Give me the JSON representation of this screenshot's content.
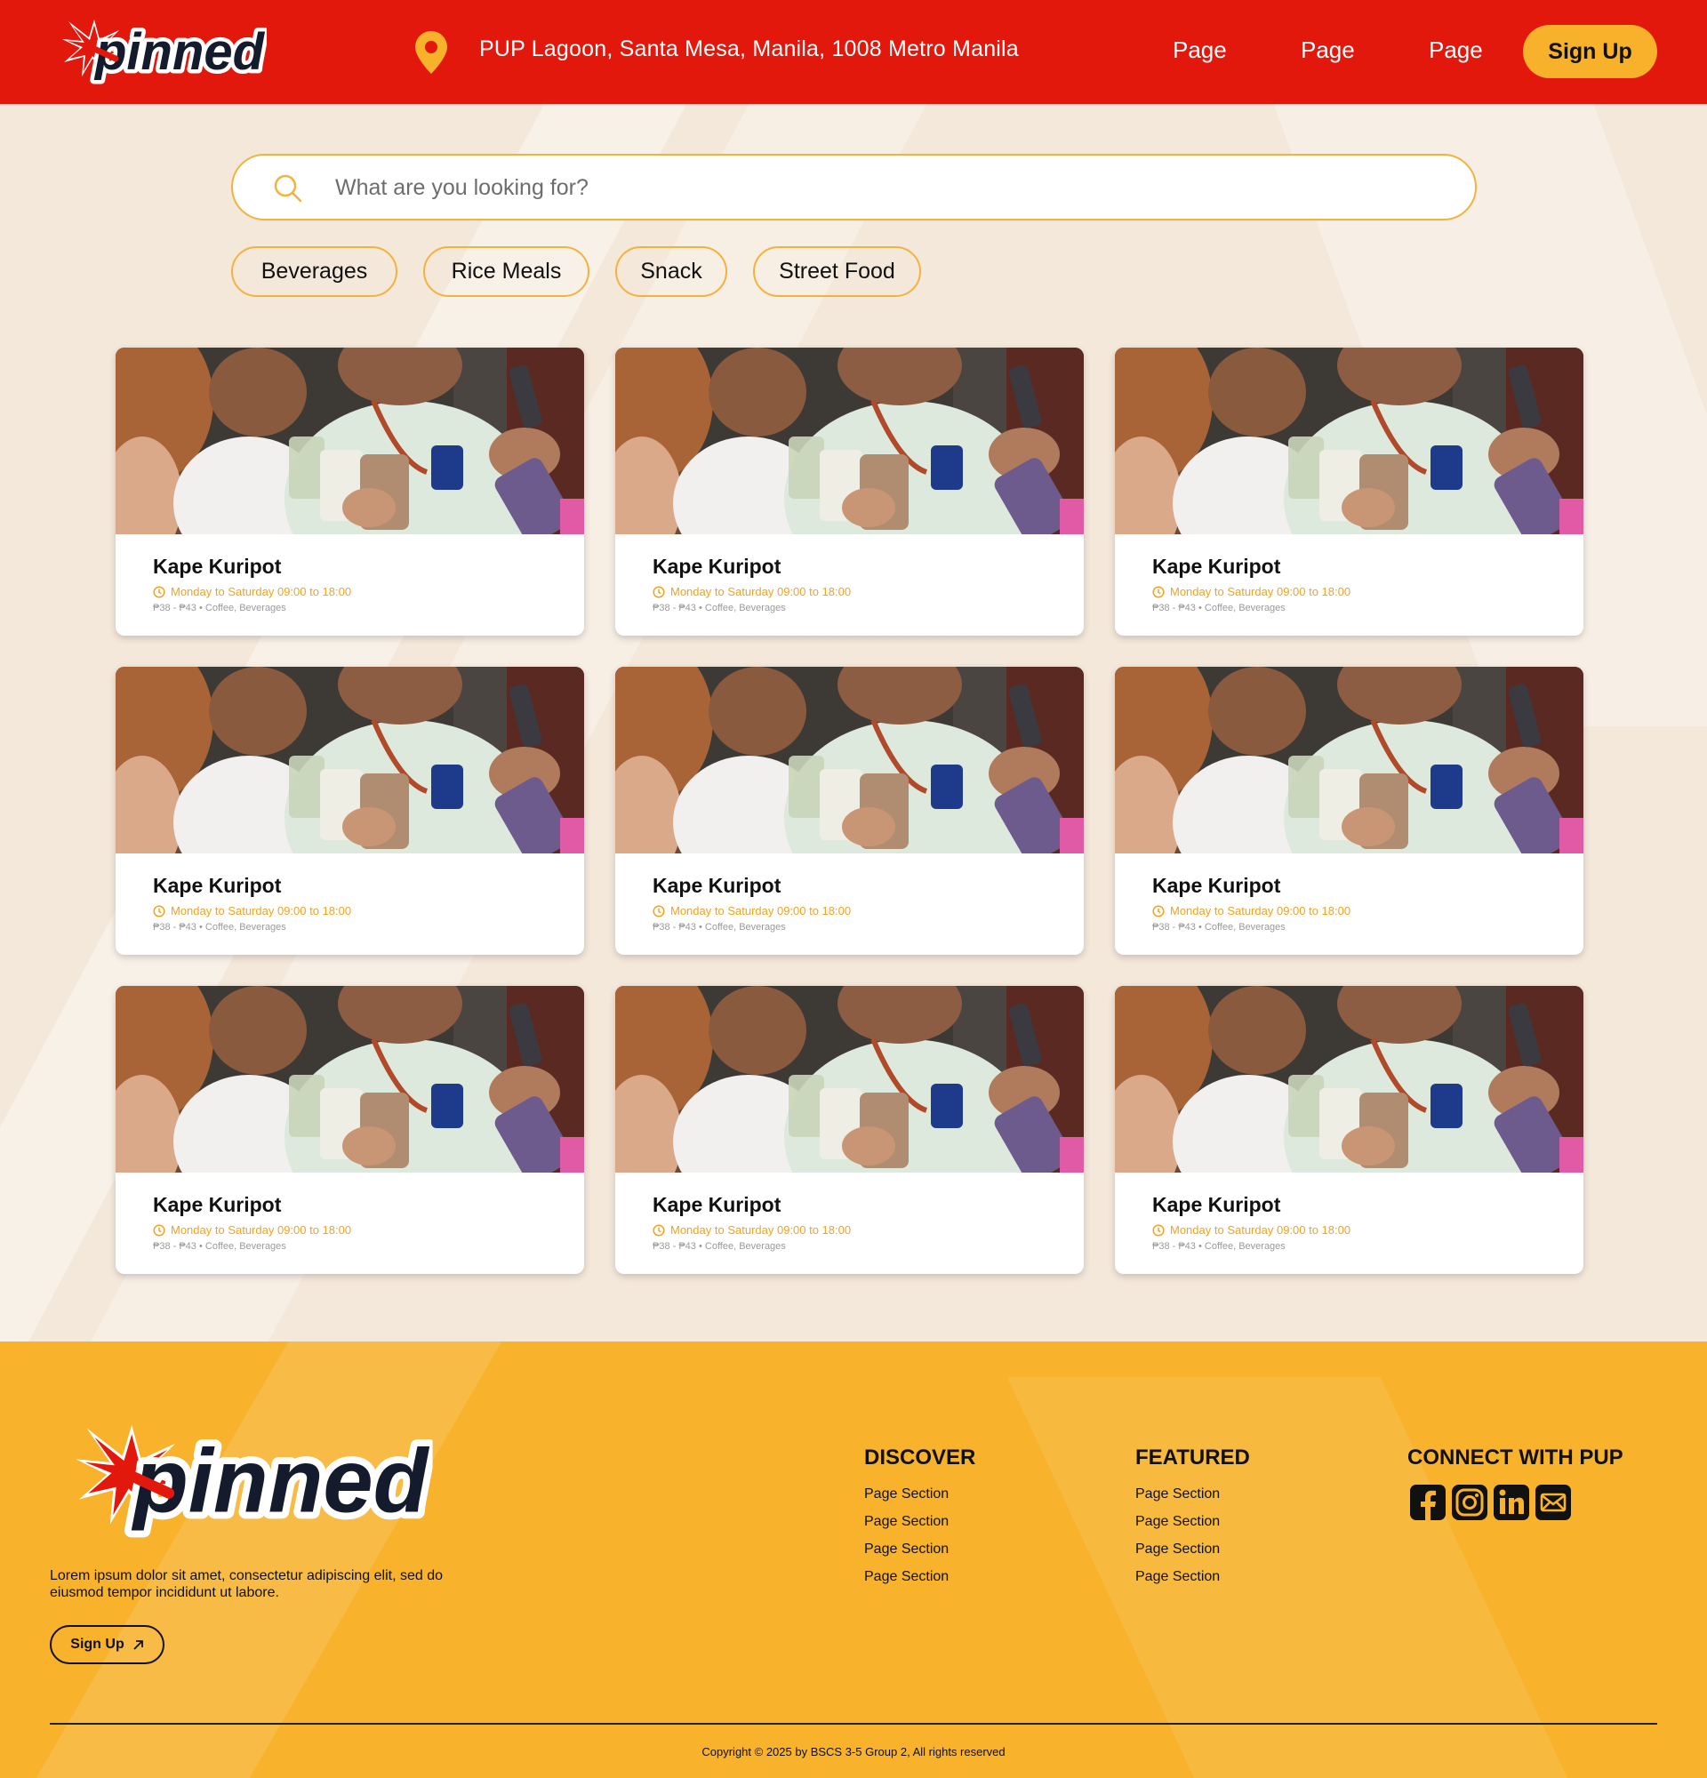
{
  "header": {
    "logo_text": "pinned",
    "location": "PUP Lagoon, Santa Mesa, Manila, 1008 Metro Manila",
    "nav": [
      "Page",
      "Page",
      "Page"
    ],
    "signup_label": "Sign Up",
    "colors": {
      "bar": "#e3180c",
      "accent": "#f7b12b"
    }
  },
  "search": {
    "placeholder": "What are you looking for?"
  },
  "categories": [
    "Beverages",
    "Rice Meals",
    "Snack",
    "Street Food"
  ],
  "cards": [
    {
      "title": "Kape Kuripot",
      "hours": "Monday to Saturday 09:00 to 18:00",
      "meta": "₱38 - ₱43 • Coffee, Beverages"
    },
    {
      "title": "Kape Kuripot",
      "hours": "Monday to Saturday 09:00 to 18:00",
      "meta": "₱38 - ₱43 • Coffee, Beverages"
    },
    {
      "title": "Kape Kuripot",
      "hours": "Monday to Saturday 09:00 to 18:00",
      "meta": "₱38 - ₱43 • Coffee, Beverages"
    },
    {
      "title": "Kape Kuripot",
      "hours": "Monday to Saturday 09:00 to 18:00",
      "meta": "₱38 - ₱43 • Coffee, Beverages"
    },
    {
      "title": "Kape Kuripot",
      "hours": "Monday to Saturday 09:00 to 18:00",
      "meta": "₱38 - ₱43 • Coffee, Beverages"
    },
    {
      "title": "Kape Kuripot",
      "hours": "Monday to Saturday 09:00 to 18:00",
      "meta": "₱38 - ₱43 • Coffee, Beverages"
    },
    {
      "title": "Kape Kuripot",
      "hours": "Monday to Saturday 09:00 to 18:00",
      "meta": "₱38 - ₱43 • Coffee, Beverages"
    },
    {
      "title": "Kape Kuripot",
      "hours": "Monday to Saturday 09:00 to 18:00",
      "meta": "₱38 - ₱43 • Coffee, Beverages"
    },
    {
      "title": "Kape Kuripot",
      "hours": "Monday to Saturday 09:00 to 18:00",
      "meta": "₱38 - ₱43 • Coffee, Beverages"
    }
  ],
  "footer": {
    "logo_text": "pinned",
    "description": "Lorem ipsum dolor sit amet, consectetur adipiscing elit, sed do eiusmod tempor incididunt ut labore.",
    "signup_label": "Sign Up",
    "discover": {
      "title": "DISCOVER",
      "links": [
        "Page Section",
        "Page Section",
        "Page Section",
        "Page Section"
      ]
    },
    "featured": {
      "title": "FEATURED",
      "links": [
        "Page Section",
        "Page Section",
        "Page Section",
        "Page Section"
      ]
    },
    "connect": {
      "title": "CONNECT WITH PUP",
      "icons": [
        "facebook-icon",
        "instagram-icon",
        "linkedin-icon",
        "mail-icon"
      ]
    },
    "copyright": "Copyright  © 2025 by BSCS 3-5 Group 2, All rights reserved",
    "colors": {
      "bg": "#f8b22c"
    }
  }
}
